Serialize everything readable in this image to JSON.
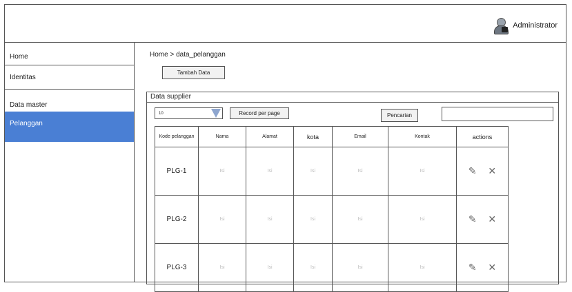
{
  "header": {
    "user": "Administrator"
  },
  "sidebar": {
    "items": [
      "Home",
      "Identitas",
      "Data master",
      "Pelanggan"
    ]
  },
  "breadcrumb": "Home > data_pelanggan",
  "add_button": "Tambah Data",
  "panel_title": "Data supplier",
  "controls": {
    "per_page_value": "10",
    "record_label": "Record per page",
    "search_label": "Pencarian"
  },
  "table": {
    "headers": [
      "Kode pelanggan",
      "Nama",
      "Alamat",
      "kota",
      "Email",
      "Kontak",
      "actions"
    ],
    "rows": [
      {
        "kode": "PLG-1",
        "nama": "Isi",
        "alamat": "Isi",
        "kota": "Isi",
        "email": "Isi",
        "kontak": "Isi"
      },
      {
        "kode": "PLG-2",
        "nama": "Isi",
        "alamat": "Isi",
        "kota": "Isi",
        "email": "Isi",
        "kontak": "Isi"
      },
      {
        "kode": "PLG-3",
        "nama": "Isi",
        "alamat": "Isi",
        "kota": "Isi",
        "email": "Isi",
        "kontak": "Isi"
      }
    ]
  },
  "icons": {
    "edit": "edit-icon",
    "delete": "delete-icon",
    "avatar": "admin-avatar-icon"
  },
  "colors": {
    "active_nav": "#4a7fd4",
    "caret": "#8ea6cf"
  }
}
